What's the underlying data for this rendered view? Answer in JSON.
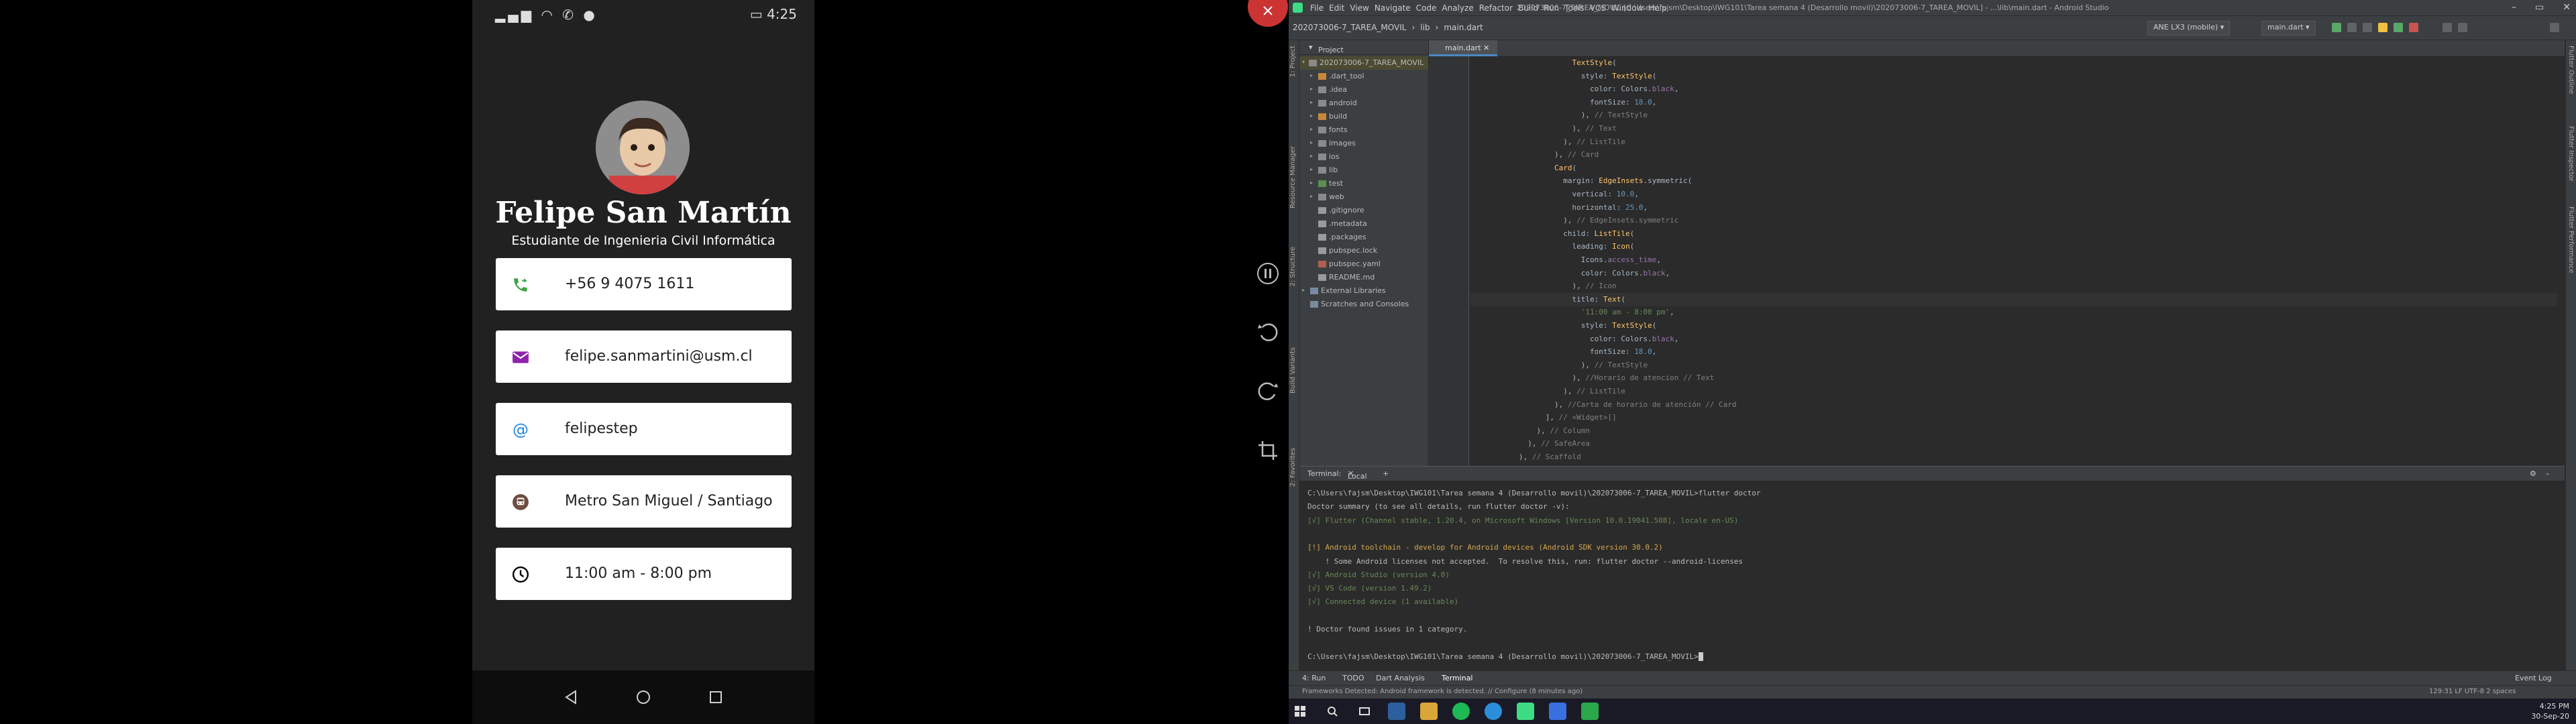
{
  "phone": {
    "status_time": "4:25",
    "profile_name": "Felipe San Martín",
    "profile_subtitle": "Estudiante de Ingenieria Civil Informática",
    "cards": [
      {
        "icon": "phone-forward-icon",
        "text": "+56 9 4075 1611",
        "color": "#43a047"
      },
      {
        "icon": "email-icon",
        "text": "felipe.sanmartini@usm.cl",
        "color": "#8e24aa"
      },
      {
        "icon": "at-sign-icon",
        "text": "felipestep",
        "color": "#1e88e5"
      },
      {
        "icon": "subway-icon",
        "text": "Metro San Miguel / Santiago",
        "color": "#6d4c41"
      },
      {
        "icon": "access-time-icon",
        "text": "11:00 am - 8:00 pm",
        "color": "#000000"
      }
    ]
  },
  "ide": {
    "menus": [
      "File",
      "Edit",
      "View",
      "Navigate",
      "Code",
      "Analyze",
      "Refactor",
      "Build",
      "Run",
      "Tools",
      "VCS",
      "Window",
      "Help"
    ],
    "window_title": "202073006-7_TAREA_MOVIL [C:\\Users\\fajsm\\Desktop\\IWG101\\Tarea semana 4 (Desarrollo movil)\\202073006-7_TAREA_MOVIL] - ...\\lib\\main.dart - Android Studio",
    "breadcrumbs": [
      "202073006-7_TAREA_MOVIL",
      "lib",
      "main.dart"
    ],
    "device": "ANE LX3 (mobile)",
    "run_config": "main.dart",
    "project_label": "Project",
    "project_root": "202073006-7_TAREA_MOVIL",
    "tree": [
      {
        "label": ".dart_tool",
        "indent": 1,
        "type": "folder-orange",
        "arrow": true
      },
      {
        "label": ".idea",
        "indent": 1,
        "type": "folder",
        "arrow": true
      },
      {
        "label": "android",
        "indent": 1,
        "type": "folder",
        "arrow": true
      },
      {
        "label": "build",
        "indent": 1,
        "type": "folder-orange",
        "arrow": true
      },
      {
        "label": "fonts",
        "indent": 1,
        "type": "folder",
        "arrow": true
      },
      {
        "label": "images",
        "indent": 1,
        "type": "folder",
        "arrow": true
      },
      {
        "label": "ios",
        "indent": 1,
        "type": "folder",
        "arrow": true
      },
      {
        "label": "lib",
        "indent": 1,
        "type": "folder",
        "arrow": true
      },
      {
        "label": "test",
        "indent": 1,
        "type": "folder-green",
        "arrow": true
      },
      {
        "label": "web",
        "indent": 1,
        "type": "folder",
        "arrow": true
      },
      {
        "label": ".gitignore",
        "indent": 1,
        "type": "file",
        "arrow": false
      },
      {
        "label": ".metadata",
        "indent": 1,
        "type": "file",
        "arrow": false
      },
      {
        "label": ".packages",
        "indent": 1,
        "type": "file",
        "arrow": false
      },
      {
        "label": "pubspec.lock",
        "indent": 1,
        "type": "file",
        "arrow": false
      },
      {
        "label": "pubspec.yaml",
        "indent": 1,
        "type": "file-yaml",
        "arrow": false
      },
      {
        "label": "README.md",
        "indent": 1,
        "type": "file",
        "arrow": false
      },
      {
        "label": "External Libraries",
        "indent": 0,
        "type": "lib",
        "arrow": true
      },
      {
        "label": "Scratches and Consoles",
        "indent": 0,
        "type": "scratch",
        "arrow": false
      }
    ],
    "editor_tab": "main.dart",
    "code_lines": [
      {
        "n": "",
        "html": "            <span class=\"cls\">TextStyle</span>("
      },
      {
        "n": "",
        "html": "              style: <span class=\"cls\">TextStyle</span>("
      },
      {
        "n": "",
        "html": "                color: Colors.<span class=\"prop\">black</span>,"
      },
      {
        "n": "",
        "html": "                fontSize: <span class=\"num\">18.0</span>,"
      },
      {
        "n": "",
        "html": "              ), <span class=\"cm\">// TextStyle</span>"
      },
      {
        "n": "",
        "html": "            ), <span class=\"cm\">// Text</span>"
      },
      {
        "n": "",
        "html": "          ), <span class=\"cm\">// ListTile</span>"
      },
      {
        "n": "",
        "html": "        ), <span class=\"cm\">// Card</span>"
      },
      {
        "n": "",
        "html": "        <span class=\"cls\">Card</span>("
      },
      {
        "n": "",
        "html": "          margin: <span class=\"cls\">EdgeInsets</span>.symmetric("
      },
      {
        "n": "",
        "html": "            vertical: <span class=\"num\">10.0</span>,"
      },
      {
        "n": "",
        "html": "            horizontal: <span class=\"num\">25.0</span>,"
      },
      {
        "n": "",
        "html": "          ), <span class=\"cm\">// EdgeInsets.symmetric</span>"
      },
      {
        "n": "",
        "html": "          child: <span class=\"cls\">ListTile</span>("
      },
      {
        "n": "",
        "html": "            leading: <span class=\"cls\">Icon</span>("
      },
      {
        "n": "",
        "html": "              Icons.<span class=\"prop\">access_time</span>,"
      },
      {
        "n": "",
        "html": "              color: Colors.<span class=\"prop\">black</span>,"
      },
      {
        "n": "",
        "html": "            ), <span class=\"cm\">// Icon</span>"
      },
      {
        "n": "",
        "html": "            title: <span class=\"cls\">Text</span>("
      },
      {
        "n": "",
        "html": "              <span class=\"str\">'11:00 am - 8:00 pm'</span>,"
      },
      {
        "n": "",
        "html": "              style: <span class=\"cls\">TextStyle</span>("
      },
      {
        "n": "",
        "html": "                color: Colors.<span class=\"prop\">black</span>,"
      },
      {
        "n": "",
        "html": "                fontSize: <span class=\"num\">18.0</span>,"
      },
      {
        "n": "",
        "html": "              ), <span class=\"cm\">// TextStyle</span>"
      },
      {
        "n": "",
        "html": "            ), <span class=\"cm\">//Horario de atencion // Text</span>"
      },
      {
        "n": "",
        "html": "          ), <span class=\"cm\">// ListTile</span>"
      },
      {
        "n": "",
        "html": "        ), <span class=\"cm\">//Carta de horario de atención // Card</span>"
      },
      {
        "n": "",
        "html": "      ], <span class=\"cm\">// &lt;Widget&gt;[]</span>"
      },
      {
        "n": "",
        "html": "    ), <span class=\"cm\">// Column</span>"
      },
      {
        "n": "",
        "html": "  ), <span class=\"cm\">// SafeArea</span>"
      },
      {
        "n": "",
        "html": "), <span class=\"cm\">// Scaffold</span>"
      }
    ],
    "terminal_tabs": [
      "Terminal:",
      "Local"
    ],
    "terminal_lines": [
      {
        "cls": "",
        "text": "C:\\Users\\fajsm\\Desktop\\IWG101\\Tarea semana 4 (Desarrollo movil)\\202073006-7_TAREA_MOVIL>flutter doctor"
      },
      {
        "cls": "",
        "text": "Doctor summary (to see all details, run flutter doctor -v):"
      },
      {
        "cls": "ok",
        "text": "[√] Flutter (Channel stable, 1.20.4, on Microsoft Windows [Version 10.0.19041.508], locale en-US)"
      },
      {
        "cls": "",
        "text": ""
      },
      {
        "cls": "warn",
        "text": "[!] Android toolchain - develop for Android devices (Android SDK version 30.0.2)"
      },
      {
        "cls": "",
        "text": "    ! Some Android licenses not accepted.  To resolve this, run: flutter doctor --android-licenses"
      },
      {
        "cls": "ok",
        "text": "[√] Android Studio (version 4.0)"
      },
      {
        "cls": "ok",
        "text": "[√] VS Code (version 1.49.2)"
      },
      {
        "cls": "ok",
        "text": "[√] Connected device (1 available)"
      },
      {
        "cls": "",
        "text": ""
      },
      {
        "cls": "",
        "text": "! Doctor found issues in 1 category."
      },
      {
        "cls": "",
        "text": ""
      },
      {
        "cls": "",
        "text": "C:\\Users\\fajsm\\Desktop\\IWG101\\Tarea semana 4 (Desarrollo movil)\\202073006-7_TAREA_MOVIL>"
      }
    ],
    "bottom_tabs": [
      "4: Run",
      "TODO",
      "Dart Analysis",
      "Terminal"
    ],
    "event_log": "Event Log",
    "status_left": "Frameworks Detected: Android framework is detected. // Configure (8 minutes ago)",
    "status_right": "129:31   LF   UTF-8   2 spaces",
    "left_strip": [
      "1: Project",
      "Resource Manager",
      "2: Structure",
      "Build Variants",
      "2: Favorites"
    ],
    "right_strip": [
      "Flutter Outline",
      "Flutter Inspector",
      "Flutter Performance"
    ],
    "clock_time": "4:25 PM",
    "clock_date": "30-Sep-20"
  }
}
